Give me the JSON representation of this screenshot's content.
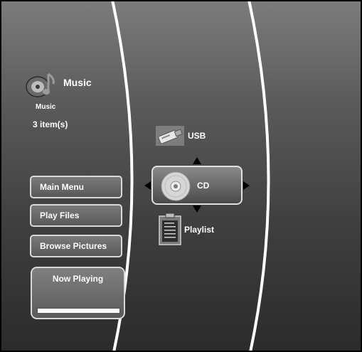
{
  "header": {
    "title": "Music",
    "subtitle": "Music",
    "item_count": "3 item(s)"
  },
  "menu": {
    "main_menu": "Main Menu",
    "play_files": "Play Files",
    "browse_pictures": "Browse Pictures"
  },
  "now_playing": {
    "title": "Now Playing",
    "progress": 1.0
  },
  "sources": [
    {
      "label": "USB",
      "icon": "usb-drive-icon",
      "selected": false
    },
    {
      "label": "CD",
      "icon": "cd-disc-icon",
      "selected": true
    },
    {
      "label": "Playlist",
      "icon": "playlist-clipboard-icon",
      "selected": false
    }
  ],
  "colors": {
    "background_top": "#7c7c7c",
    "background_bottom": "#2b2b2b",
    "text": "#ffffff",
    "button_border": "#d8d8d8"
  }
}
